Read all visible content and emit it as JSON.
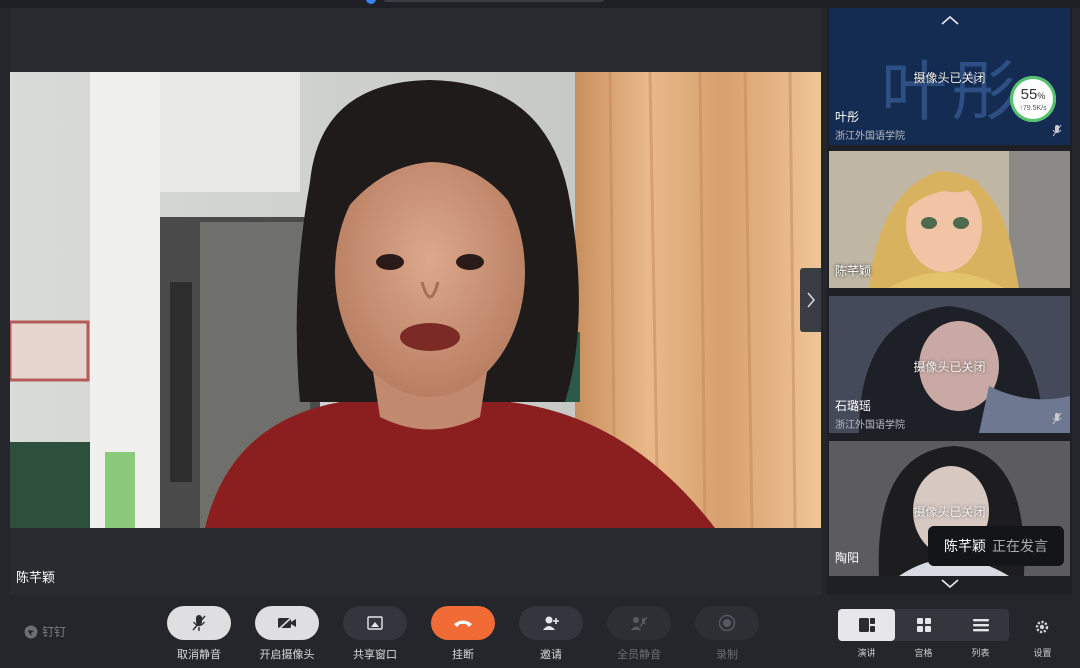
{
  "main": {
    "speaker_name": "陈芊颖",
    "next_icon": "chevron-right-icon"
  },
  "sidebar": {
    "up_icon": "chevron-up-icon",
    "down_icon": "chevron-down-icon",
    "participants": [
      {
        "name": "叶彤",
        "org": "浙江外国语学院",
        "camera_status": "摄像头已关闭",
        "avatar_text": "叶彤",
        "network_percent": "55",
        "percent_sign": "%",
        "speed": "↑79.5K/s",
        "muted": true
      },
      {
        "name": "陈芊颖",
        "org": "",
        "camera_status": "",
        "active": true,
        "muted": false
      },
      {
        "name": "石璐瑶",
        "org": "浙江外国语学院",
        "camera_status": "摄像头已关闭",
        "muted": true
      },
      {
        "name": "陶阳",
        "org": "",
        "camera_status": "摄像头已关闭",
        "muted": false
      }
    ]
  },
  "toast": {
    "name": "陈芊颖",
    "status": "正在发言"
  },
  "toolbar": {
    "brand": "钉钉",
    "buttons": [
      {
        "label": "取消静音",
        "icon": "microphone-icon",
        "enabled": true
      },
      {
        "label": "开启摄像头",
        "icon": "camera-off-icon",
        "enabled": true
      },
      {
        "label": "共享窗口",
        "icon": "share-screen-icon",
        "enabled": true
      },
      {
        "label": "挂断",
        "icon": "hang-up-icon",
        "enabled": true,
        "color": "#f06b36"
      },
      {
        "label": "邀请",
        "icon": "add-user-icon",
        "enabled": true
      },
      {
        "label": "全员静音",
        "icon": "mute-all-icon",
        "enabled": false
      },
      {
        "label": "录制",
        "icon": "record-icon",
        "enabled": false
      }
    ],
    "views": [
      {
        "label": "演讲",
        "icon": "speaker-view-icon",
        "selected": true
      },
      {
        "label": "宫格",
        "icon": "grid-view-icon",
        "selected": false
      },
      {
        "label": "列表",
        "icon": "list-view-icon",
        "selected": false
      }
    ],
    "settings_label": "设置",
    "settings_icon": "gear-icon"
  },
  "colors": {
    "accent_green": "#52c36b",
    "hangup": "#f06b36",
    "background": "#24262b"
  }
}
